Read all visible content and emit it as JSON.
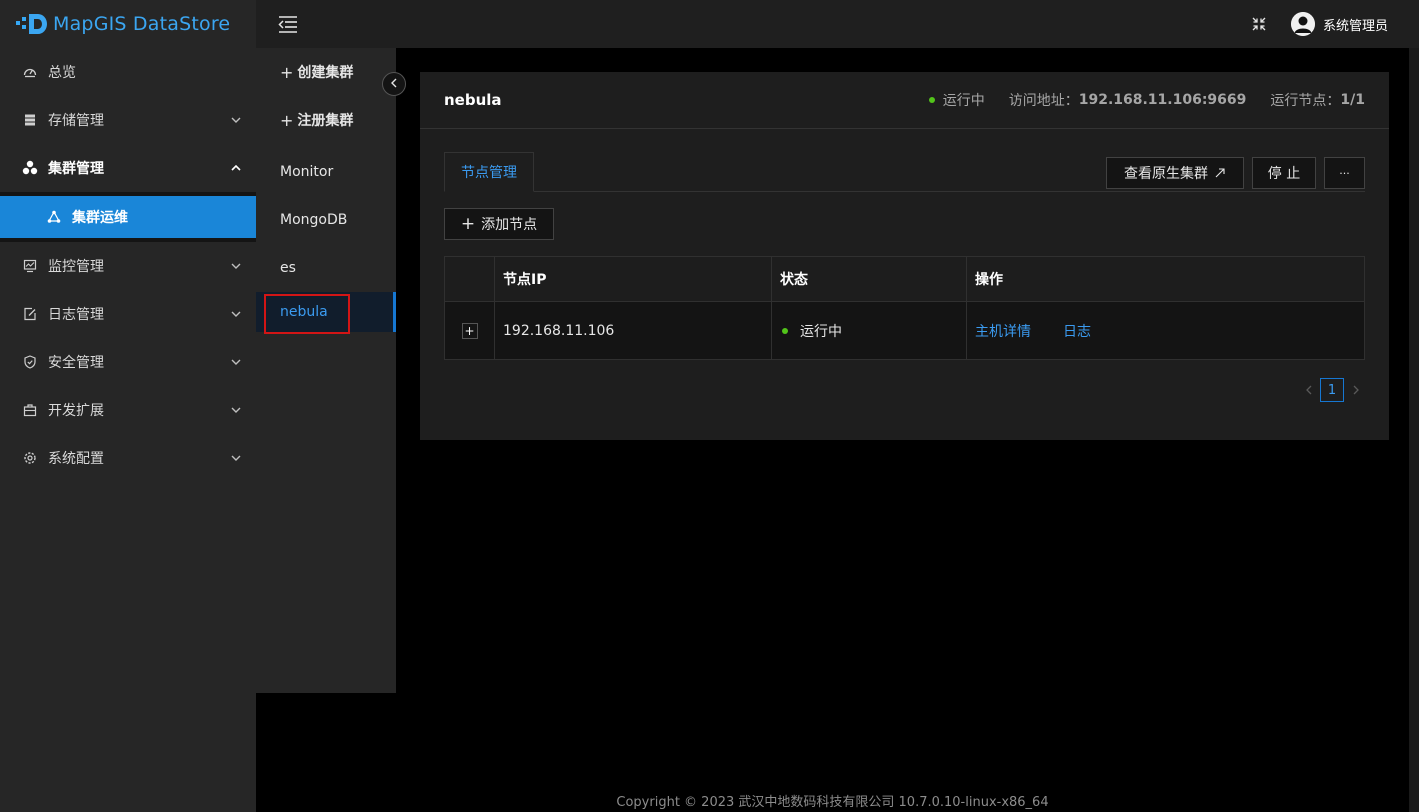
{
  "app": {
    "name": "MapGIS DataStore"
  },
  "header": {
    "user_name": "系统管理员"
  },
  "sidebar": {
    "items": [
      {
        "label": "总览"
      },
      {
        "label": "存储管理"
      },
      {
        "label": "集群管理"
      },
      {
        "label": "集群运维"
      },
      {
        "label": "监控管理"
      },
      {
        "label": "日志管理"
      },
      {
        "label": "安全管理"
      },
      {
        "label": "开发扩展"
      },
      {
        "label": "系统配置"
      }
    ]
  },
  "cluster_list": {
    "create_label": "创建集群",
    "register_label": "注册集群",
    "items": [
      "Monitor",
      "MongoDB",
      "es",
      "nebula"
    ]
  },
  "detail": {
    "title": "nebula",
    "status_text": "运行中",
    "address_label": "访问地址：",
    "address_value": "192.168.11.106:9669",
    "nodes_label": "运行节点：",
    "nodes_value": "1/1",
    "tab_label": "节点管理",
    "view_native_label": "查看原生集群",
    "stop_label": "停 止",
    "more_label": "···",
    "add_node_label": "添加节点",
    "table": {
      "columns": [
        "节点IP",
        "状态",
        "操作"
      ],
      "rows": [
        {
          "ip": "192.168.11.106",
          "status": "运行中",
          "action_detail": "主机详情",
          "action_log": "日志"
        }
      ]
    },
    "pagination": {
      "current": "1"
    }
  },
  "footer": {
    "text": "Copyright © 2023 武汉中地数码科技有限公司 10.7.0.10-linux-x86_64"
  },
  "colors": {
    "accent": "#1a86d8",
    "link": "#3b9bf0",
    "success": "#52c41a",
    "highlight": "#d21515"
  }
}
